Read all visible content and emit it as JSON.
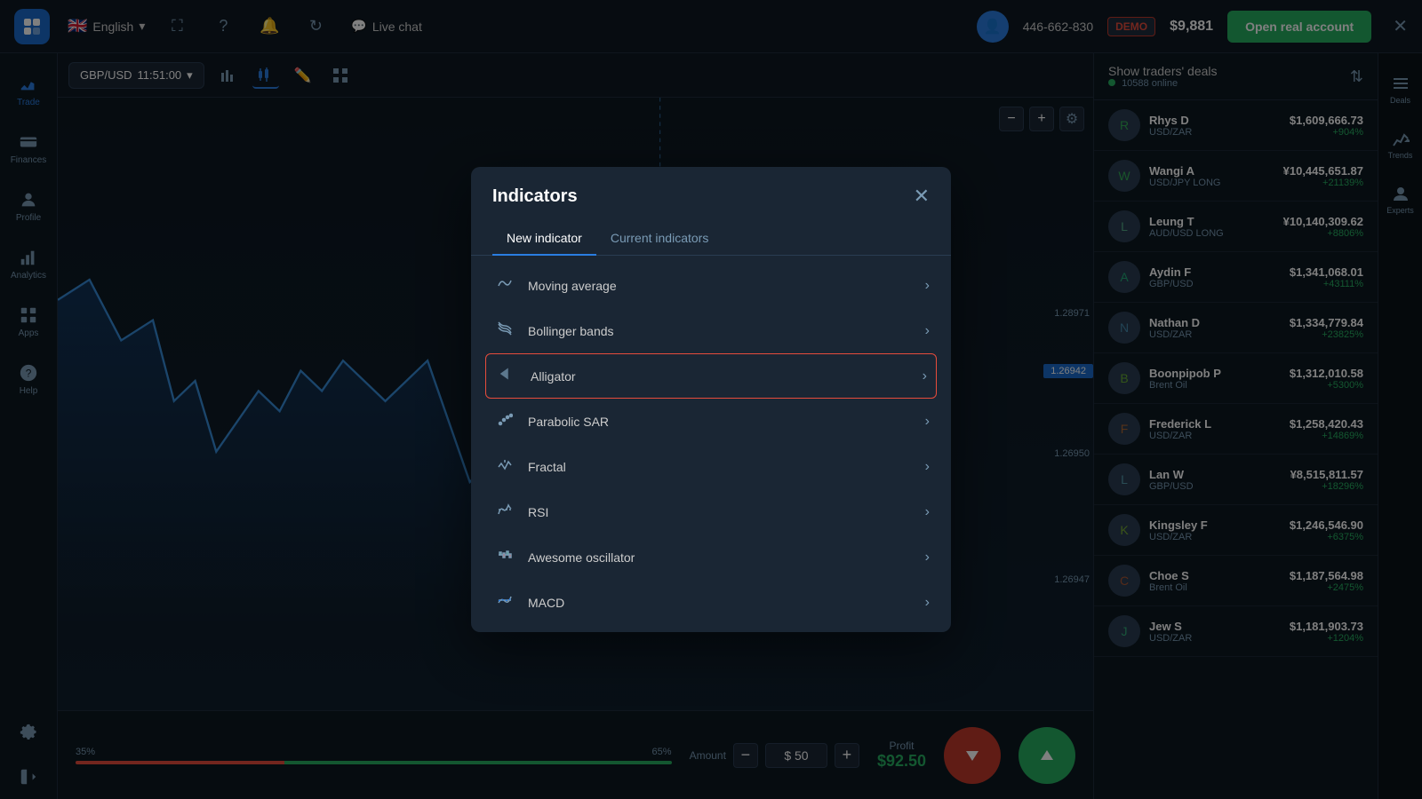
{
  "topbar": {
    "logo": "Q",
    "lang": "English",
    "flag": "🇬🇧",
    "icons": [
      "⛶",
      "?",
      "🔔",
      "↻"
    ],
    "live_chat_label": "Live chat",
    "account_id": "446-662-830",
    "demo_badge": "DEMO",
    "balance": "$9,881",
    "open_real_label": "Open real account",
    "close_icon": "✕"
  },
  "sidebar": {
    "items": [
      {
        "label": "Trade",
        "icon": "trade"
      },
      {
        "label": "Finances",
        "icon": "finances"
      },
      {
        "label": "Profile",
        "icon": "profile"
      },
      {
        "label": "Analytics",
        "icon": "analytics"
      },
      {
        "label": "Apps",
        "icon": "apps"
      },
      {
        "label": "Help",
        "icon": "help"
      }
    ],
    "bottom_items": [
      {
        "label": "Settings",
        "icon": "settings"
      },
      {
        "label": "Logout",
        "icon": "logout"
      }
    ]
  },
  "chart": {
    "pair": "GBP/USD",
    "time": "11:51:00",
    "icons": [
      "bar",
      "candle",
      "pencil",
      "grid"
    ]
  },
  "trade_panel": {
    "slider_left": "35%",
    "slider_right": "65%",
    "amount_label": "Amount",
    "amount_value": "$ 50",
    "profit_label": "Profit",
    "profit_value": "$92.50",
    "btn_down": "↓",
    "btn_up": "↑"
  },
  "indicators_modal": {
    "title": "Indicators",
    "close": "✕",
    "tabs": [
      {
        "label": "New indicator",
        "active": true
      },
      {
        "label": "Current indicators",
        "active": false
      }
    ],
    "items": [
      {
        "label": "Moving average",
        "icon": "〜",
        "highlighted": false
      },
      {
        "label": "Bollinger bands",
        "icon": "⟰",
        "highlighted": false
      },
      {
        "label": "Alligator",
        "icon": "◁",
        "highlighted": true
      },
      {
        "label": "Parabolic SAR",
        "icon": "⁚",
        "highlighted": false
      },
      {
        "label": "Fractal",
        "icon": "⥂",
        "highlighted": false
      },
      {
        "label": "RSI",
        "icon": "≋",
        "highlighted": false
      },
      {
        "label": "Awesome oscillator",
        "icon": "⇌",
        "highlighted": false
      },
      {
        "label": "MACD",
        "icon": "⇄",
        "highlighted": false
      }
    ],
    "arrow": "›"
  },
  "traders": {
    "title": "Show traders' deals",
    "online_count": "10588 online",
    "list": [
      {
        "name": "Rhys D",
        "pair": "USD/ZAR",
        "amount": "$1,609,666.73",
        "pct": "+904%",
        "positive": true,
        "color": "#3a5"
      },
      {
        "name": "Wangi A",
        "pair": "USD/JPY LONG",
        "amount": "¥10,445,651.87",
        "pct": "+21139%",
        "positive": true,
        "color": "#3a5"
      },
      {
        "name": "Leung T",
        "pair": "AUD/USD LONG",
        "amount": "¥10,140,309.62",
        "pct": "+8806%",
        "positive": true,
        "color": "#5a8"
      },
      {
        "name": "Aydin F",
        "pair": "GBP/USD",
        "amount": "$1,341,068.01",
        "pct": "+43111%",
        "positive": true,
        "color": "#2a7"
      },
      {
        "name": "Nathan D",
        "pair": "USD/ZAR",
        "amount": "$1,334,779.84",
        "pct": "+23825%",
        "positive": true,
        "color": "#48a"
      },
      {
        "name": "Boonpipob P",
        "pair": "Brent Oil",
        "amount": "$1,312,010.58",
        "pct": "+5300%",
        "positive": true,
        "color": "#6a3"
      },
      {
        "name": "Frederick L",
        "pair": "USD/ZAR",
        "amount": "$1,258,420.43",
        "pct": "+14869%",
        "positive": true,
        "color": "#a63"
      },
      {
        "name": "Lan W",
        "pair": "GBP/USD",
        "amount": "¥8,515,811.57",
        "pct": "+18296%",
        "positive": true,
        "color": "#59a"
      },
      {
        "name": "Kingsley F",
        "pair": "USD/ZAR",
        "amount": "$1,246,546.90",
        "pct": "+6375%",
        "positive": true,
        "color": "#7a3"
      },
      {
        "name": "Choe S",
        "pair": "Brent Oil",
        "amount": "$1,187,564.98",
        "pct": "+2475%",
        "positive": true,
        "color": "#a53"
      },
      {
        "name": "Jew S",
        "pair": "USD/ZAR",
        "amount": "$1,181,903.73",
        "pct": "+1204%",
        "positive": true,
        "color": "#3a7"
      }
    ]
  },
  "far_right": {
    "items": [
      {
        "label": "Deals",
        "icon": "≡"
      },
      {
        "label": "Trends",
        "icon": "⚡"
      },
      {
        "label": "Experts",
        "icon": "👤"
      }
    ]
  }
}
